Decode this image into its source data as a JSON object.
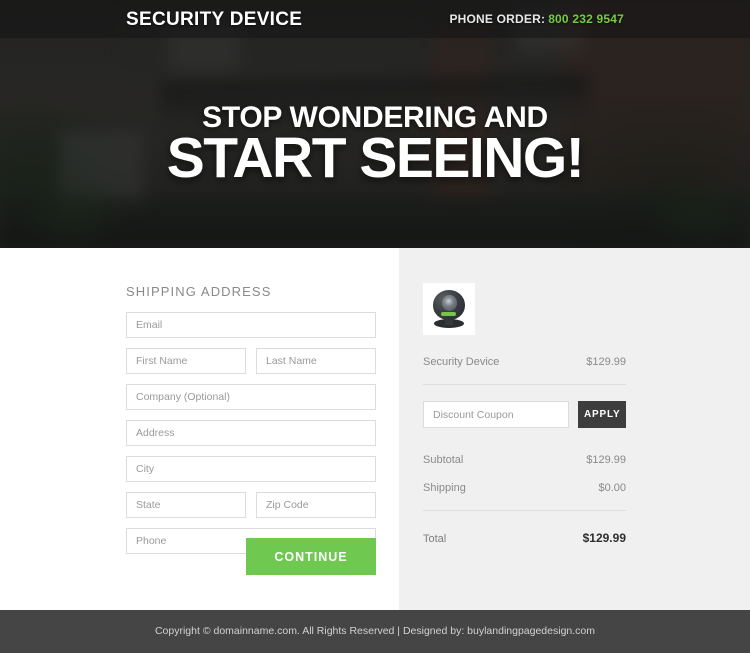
{
  "header": {
    "brand": "SECURITY DEVICE",
    "phone_label": "PHONE ORDER:",
    "phone_number": "800 232 9547",
    "phone_color": "#76cc3f"
  },
  "hero": {
    "headline_sub": "STOP WONDERING AND",
    "headline_main": "START SEEING!"
  },
  "form": {
    "section_title": "SHIPPING ADDRESS",
    "email_placeholder": "Email",
    "email_value": "",
    "first_name_placeholder": "First Name",
    "first_name_value": "",
    "last_name_placeholder": "Last Name",
    "last_name_value": "",
    "company_placeholder": "Company (Optional)",
    "company_value": "",
    "address_placeholder": "Address",
    "address_value": "",
    "city_placeholder": "City",
    "city_value": "",
    "state_placeholder": "State",
    "state_value": "",
    "zip_placeholder": "Zip Code",
    "zip_value": "",
    "phone_placeholder": "Phone",
    "phone_value": "",
    "continue_label": "CONTINUE",
    "continue_color": "#6fc84f"
  },
  "summary": {
    "product_name": "Security Device",
    "product_price": "$129.99",
    "product_icon": "security-camera-icon",
    "coupon_placeholder": "Discount Coupon",
    "coupon_value": "",
    "apply_label": "APPLY",
    "apply_color": "#3d3d3d",
    "subtotal_label": "Subtotal",
    "subtotal_value": "$129.99",
    "shipping_label": "Shipping",
    "shipping_value": "$0.00",
    "total_label": "Total",
    "total_value": "$129.99"
  },
  "footer": {
    "text": "Copyright © domainname.com.  All Rights Reserved  |  Designed by: buylandingpagedesign.com",
    "background": "#454545"
  }
}
